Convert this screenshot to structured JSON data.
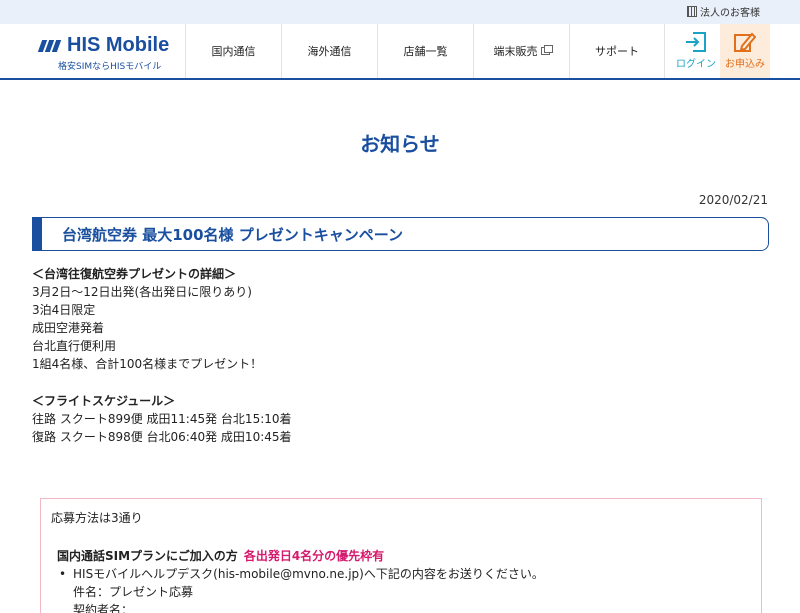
{
  "topbar": {
    "corporate_label": "法人のお客様"
  },
  "header": {
    "logo_text": "HIS Mobile",
    "logo_sub": "格安SIMならHISモバイル",
    "nav": [
      {
        "label": "国内通信"
      },
      {
        "label": "海外通信"
      },
      {
        "label": "店舗一覧"
      },
      {
        "label": "端末販売"
      },
      {
        "label": "サポート"
      }
    ],
    "login_label": "ログイン",
    "apply_label": "お申込み"
  },
  "page": {
    "title": "お知らせ",
    "date": "2020/02/21",
    "article_title": "台湾航空券 最大100名様 プレゼントキャンペーン"
  },
  "details": {
    "heading": "＜台湾往復航空券プレゼントの詳細＞",
    "lines": [
      "3月2日〜12日出発(各出発日に限りあり)",
      "3泊4日限定",
      "成田空港発着",
      "台北直行便利用",
      "1組4名様、合計100名様までプレゼント！"
    ]
  },
  "schedule": {
    "heading": "＜フライトスケジュール＞",
    "lines": [
      "往路 スクート899便 成田11:45発 台北15:10着",
      "復路 スクート898便 台北06:40発 成田10:45着"
    ]
  },
  "apply_box": {
    "methods": "応募方法は3通り",
    "plan_label": "国内通話SIMプランにご加入の方",
    "plan_highlight": "各出発日4名分の優先枠有",
    "bullet": "HISモバイルヘルプデスク(his-mobile@mvno.ne.jp)へ下記の内容をお送りください。",
    "sub_lines": [
      "件名：プレゼント応募",
      "契約者名："
    ]
  },
  "colors": {
    "brand_blue": "#1a4fa0",
    "highlight_pink": "#d61a6e",
    "apply_orange": "#e0701c",
    "login_cyan": "#1aa3c4"
  }
}
